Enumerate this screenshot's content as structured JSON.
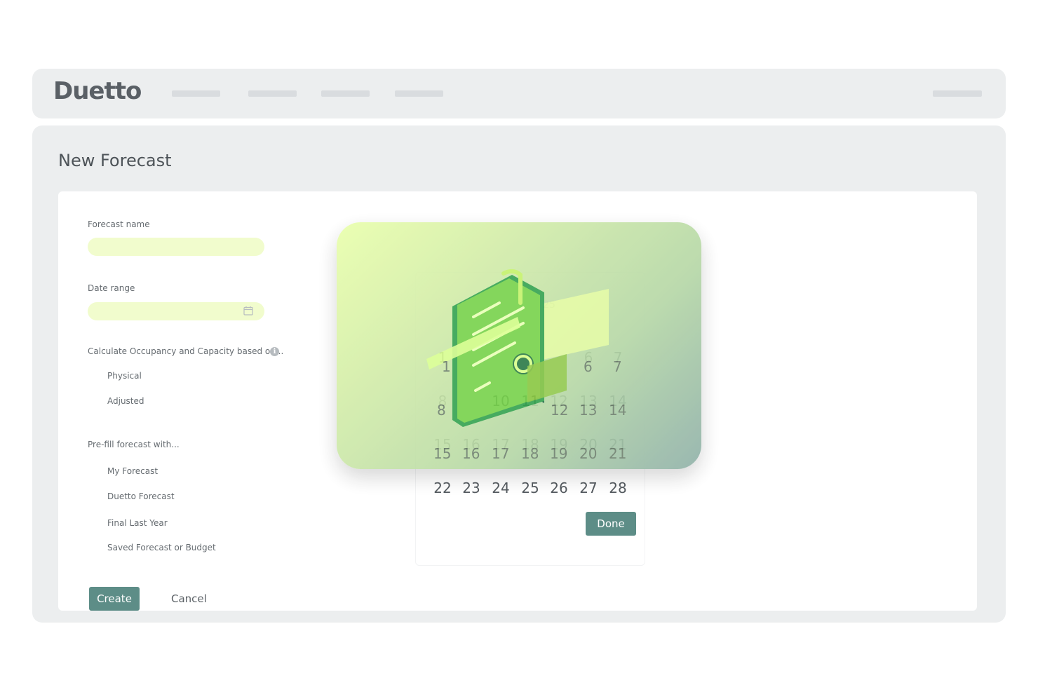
{
  "app": {
    "logo_text": "Duetto",
    "nav_items_count_note": "",
    "brand_color": "#5d8d87"
  },
  "page": {
    "title": "New Forecast"
  },
  "form": {
    "forecast_name_label": "Forecast name",
    "forecast_name_value": "",
    "date_range_label": "Date range",
    "date_range_value": "",
    "occupancy_label": "Calculate Occupancy and Capacity based on...",
    "occupancy_options": [
      "Physical",
      "Adjusted"
    ],
    "prefill_label": "Pre-fill forecast with...",
    "prefill_options": [
      "My Forecast",
      "Duetto Forecast",
      "Final Last Year",
      "Saved Forecast or Budget"
    ],
    "create_label": "Create",
    "cancel_label": "Cancel"
  },
  "date_picker": {
    "faint_day": "25",
    "rows": [
      [
        "1",
        "6",
        "7"
      ],
      [
        "8",
        "10",
        "11",
        "12",
        "13",
        "14"
      ],
      [
        "15",
        "16",
        "17",
        "18",
        "19",
        "20",
        "21"
      ],
      [
        "22",
        "23",
        "24",
        "25",
        "26",
        "27",
        "28"
      ]
    ],
    "done_label": "Done"
  },
  "icons": {
    "calendar": "calendar-icon",
    "info": "info-icon",
    "illustration": "document-illustration"
  }
}
